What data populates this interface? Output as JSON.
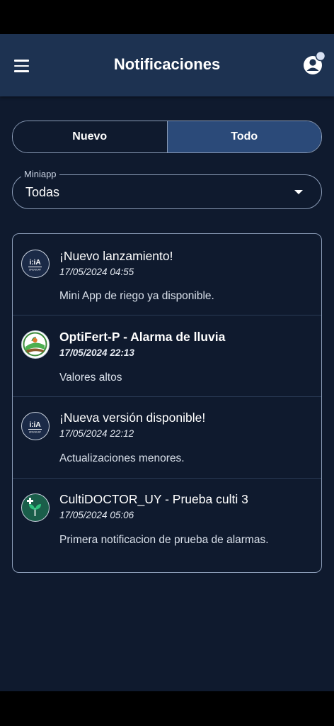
{
  "header": {
    "title": "Notificaciones",
    "menu_icon": "hamburger-menu-icon",
    "profile_icon": "user-profile-icon"
  },
  "tabs": [
    {
      "label": "Nuevo",
      "selected": false
    },
    {
      "label": "Todo",
      "selected": true
    }
  ],
  "filter": {
    "label": "Miniapp",
    "value": "Todas"
  },
  "notifications": [
    {
      "title": "¡Nuevo lanzamiento!",
      "date": "17/05/2024 04:55",
      "message": "Mini App de riego ya disponible.",
      "unread": false,
      "icon": "inia-uruguay-logo"
    },
    {
      "title": "OptiFert-P - Alarma de lluvia",
      "date": "17/05/2024 22:13",
      "message": "Valores altos",
      "unread": true,
      "icon": "optifert-logo"
    },
    {
      "title": "¡Nueva versión disponible!",
      "date": "17/05/2024 22:12",
      "message": "Actualizaciones menores.",
      "unread": false,
      "icon": "inia-uruguay-logo"
    },
    {
      "title": "CultiDOCTOR_UY - Prueba culti 3",
      "date": "17/05/2024 05:06",
      "message": "Primera notificacion de prueba de alarmas.",
      "unread": false,
      "icon": "cultidoctor-logo"
    }
  ],
  "colors": {
    "background": "#0f1a2e",
    "header": "#1d3251",
    "selected_tab": "#2b4a79",
    "border": "#8a9bb6"
  }
}
